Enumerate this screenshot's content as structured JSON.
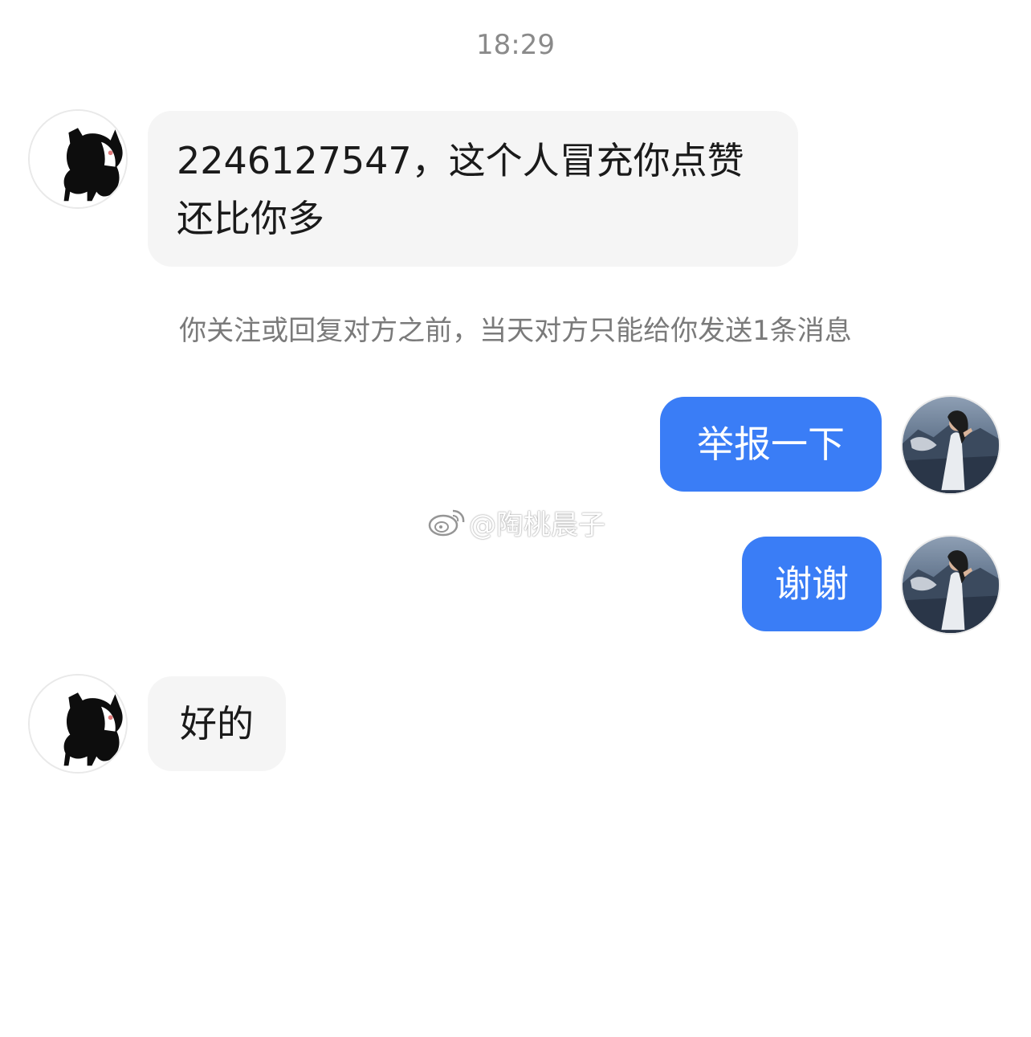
{
  "chat": {
    "timestamp": "18:29",
    "messages": [
      {
        "direction": "incoming",
        "lines": [
          "2246127547，这个人冒充你点赞",
          "还比你多"
        ],
        "avatar_icon": "black-cat-avatar-icon"
      },
      {
        "direction": "outgoing",
        "text": "举报一下",
        "avatar_icon": "girl-photo-avatar-icon"
      },
      {
        "direction": "outgoing",
        "text": "谢谢",
        "avatar_icon": "girl-photo-avatar-icon"
      },
      {
        "direction": "incoming",
        "text": "好的",
        "avatar_icon": "black-cat-avatar-icon"
      }
    ],
    "system_notice": "你关注或回复对方之前，当天对方只能给你发送1条消息"
  },
  "watermark": {
    "text": "@陶桃晨子",
    "icon": "weibo-logo-icon"
  },
  "colors": {
    "outgoing_bubble": "#3a7df6",
    "incoming_bubble": "#f5f5f5",
    "timestamp_text": "#8a8a8a"
  }
}
